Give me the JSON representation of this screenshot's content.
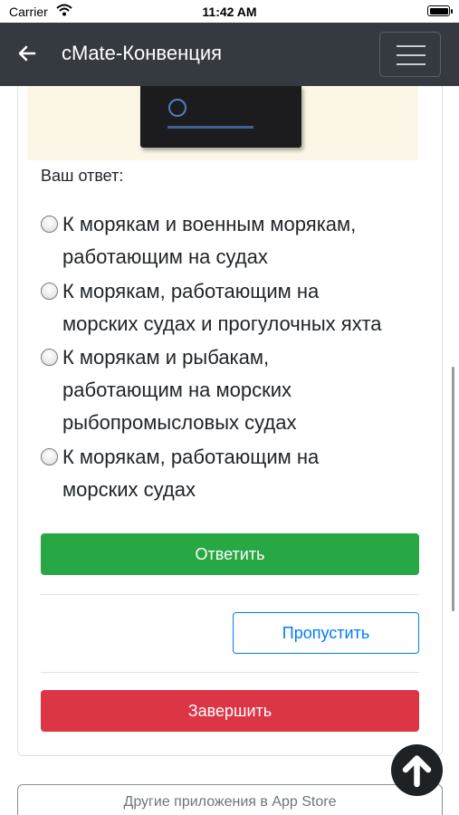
{
  "status_bar": {
    "carrier": "Carrier",
    "time": "11:42 AM"
  },
  "navbar": {
    "title": "cMate-Конвенция",
    "back_icon": "arrow-left-icon",
    "menu_icon": "hamburger-icon"
  },
  "question": {
    "answer_label": "Ваш ответ:",
    "options": [
      {
        "line1": "К морякам и военным морякам,",
        "line2": "работающим на судах",
        "line3": ""
      },
      {
        "line1": "К морякам, работающим на",
        "line2": "морских судах и прогулочных яхта",
        "line3": ""
      },
      {
        "line1": "К морякам и рыбакам,",
        "line2": "работающим на морских",
        "line3": "рыбопромысловых судах"
      },
      {
        "line1": "К морякам, работающим на",
        "line2": "морских судах",
        "line3": ""
      }
    ]
  },
  "buttons": {
    "answer": "Ответить",
    "skip": "Пропустить",
    "finish": "Завершить"
  },
  "footer": {
    "app_store_label": "Другие приложения в App Store"
  },
  "colors": {
    "navbar": "#343a40",
    "answer": "#28a745",
    "skip": "#007bff",
    "finish": "#dc3545"
  }
}
